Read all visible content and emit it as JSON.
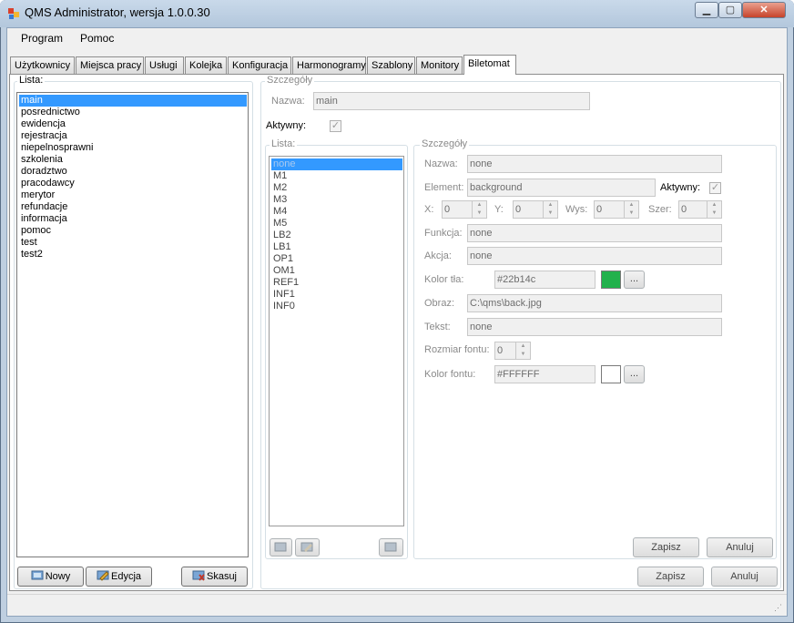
{
  "window": {
    "title": "QMS Administrator, wersja 1.0.0.30"
  },
  "menu": [
    "Program",
    "Pomoc"
  ],
  "tabs": [
    "Użytkownicy",
    "Miejsca pracy",
    "Usługi",
    "Kolejka",
    "Konfiguracja",
    "Harmonogramy",
    "Szablony",
    "Monitory",
    "Biletomat"
  ],
  "active_tab": "Biletomat",
  "left": {
    "group_label": "Lista:",
    "items": [
      "main",
      "posrednictwo",
      "ewidencja",
      "rejestracja",
      "niepelnosprawni",
      "szkolenia",
      "doradztwo",
      "pracodawcy",
      "merytor",
      "refundacje",
      "informacja",
      "pomoc",
      "test",
      "test2"
    ],
    "selected": "main",
    "buttons": {
      "new": "Nowy",
      "edit": "Edycja",
      "delete": "Skasuj"
    }
  },
  "details": {
    "group_label": "Szczegóły",
    "name_label": "Nazwa:",
    "name_value": "main",
    "active_label": "Aktywny:",
    "active_checked": true,
    "elements": {
      "group_label": "Lista:",
      "items": [
        "none",
        "M1",
        "M2",
        "M3",
        "M4",
        "M5",
        "LB2",
        "LB1",
        "OP1",
        "OM1",
        "REF1",
        "INF1",
        "INF0"
      ],
      "selected": "none"
    },
    "element_details": {
      "group_label": "Szczegóły",
      "name_label": "Nazwa:",
      "name_value": "none",
      "element_label": "Element:",
      "element_value": "background",
      "active_label": "Aktywny:",
      "active_checked": true,
      "x_label": "X:",
      "x_value": "0",
      "y_label": "Y:",
      "y_value": "0",
      "height_label": "Wys:",
      "height_value": "0",
      "width_label": "Szer:",
      "width_value": "0",
      "function_label": "Funkcja:",
      "function_value": "none",
      "action_label": "Akcja:",
      "action_value": "none",
      "bg_color_label": "Kolor tła:",
      "bg_color_value": "#22b14c",
      "bg_swatch": "#22b14c",
      "image_label": "Obraz:",
      "image_value": "C:\\qms\\back.jpg",
      "text_label": "Tekst:",
      "text_value": "none",
      "font_size_label": "Rozmiar fontu:",
      "font_size_value": "0",
      "font_color_label": "Kolor fontu:",
      "font_color_value": "#FFFFFF",
      "font_swatch": "#FFFFFF",
      "browse_label": "...",
      "save_label": "Zapisz",
      "cancel_label": "Anuluj"
    },
    "save_label": "Zapisz",
    "cancel_label": "Anuluj"
  }
}
